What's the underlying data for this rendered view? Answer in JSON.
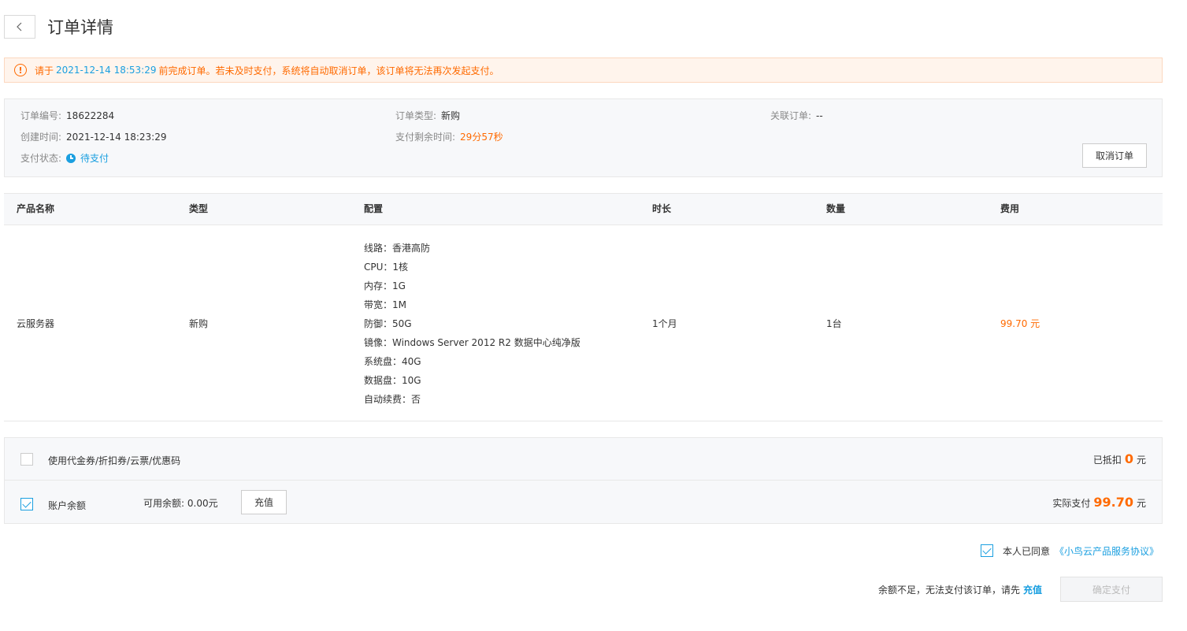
{
  "header": {
    "title": "订单详情"
  },
  "alert": {
    "prefix": "请于",
    "deadline": "2021-12-14 18:53:29",
    "suffix": "前完成订单。若未及时支付，系统将自动取消订单，该订单将无法再次发起支付。",
    "icon": "exclamation-circle-icon"
  },
  "info": {
    "order_no_label": "订单编号:",
    "order_no": "18622284",
    "created_label": "创建时间:",
    "created": "2021-12-14 18:23:29",
    "status_label": "支付状态:",
    "status": "待支付",
    "type_label": "订单类型:",
    "type": "新购",
    "remaining_label": "支付剩余时间:",
    "remaining": "29分57秒",
    "related_label": "关联订单:",
    "related": "--",
    "cancel_button": "取消订单"
  },
  "table": {
    "columns": [
      "产品名称",
      "类型",
      "配置",
      "时长",
      "数量",
      "费用"
    ],
    "rows": [
      {
        "name": "云服务器",
        "type": "新购",
        "config": [
          "线路：香港高防",
          "CPU：1核",
          "内存：1G",
          "带宽：1M",
          "防御：50G",
          "镜像：Windows Server 2012 R2 数据中心纯净版",
          "系统盘：40G",
          "数据盘：10G",
          "自动续费：否"
        ],
        "duration": "1个月",
        "quantity": "1台",
        "price": "99.70 元"
      }
    ]
  },
  "payment": {
    "coupon_label": "使用代金券/折扣券/云票/优惠码",
    "coupon_checked": false,
    "deducted_label": "已抵扣",
    "deducted_value": "0",
    "deducted_unit": "元",
    "balance_label": "账户余额",
    "balance_checked": true,
    "available_label": "可用余额:",
    "available_value": "0.00元",
    "recharge_button": "充值",
    "actual_label": "实际支付",
    "actual_value": "99.70",
    "actual_unit": "元"
  },
  "agreement": {
    "checked": true,
    "text": "本人已同意",
    "link": "《小鸟云产品服务协议》"
  },
  "footer": {
    "message": "余额不足，无法支付该订单，请先",
    "recharge_link": "充值",
    "confirm_button": "确定支付"
  },
  "colors": {
    "accent_blue": "#1a9fe0",
    "accent_orange": "#ff6a00"
  }
}
